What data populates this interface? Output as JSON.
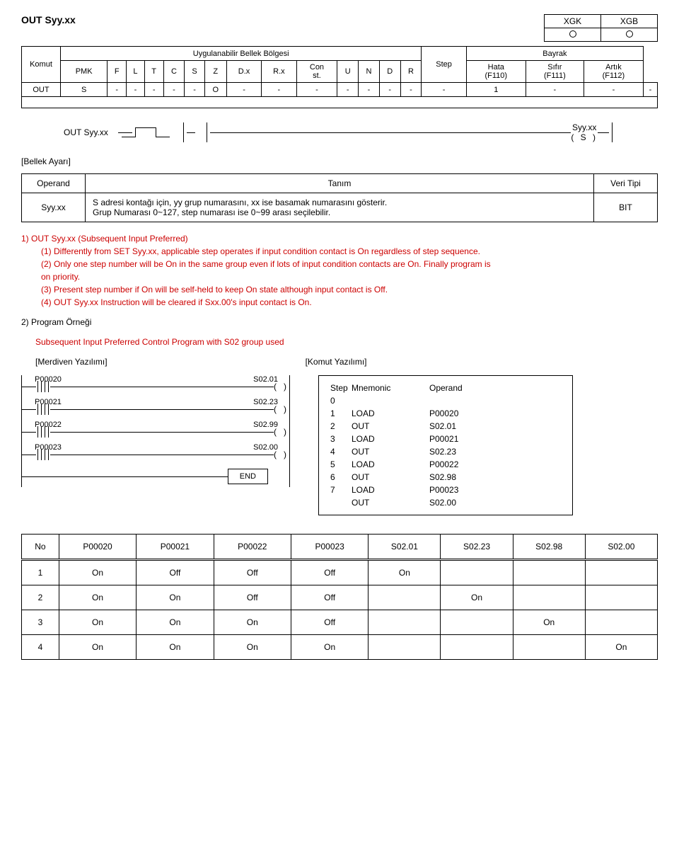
{
  "title": "OUT Syy.xx",
  "xgk": {
    "h1": "XGK",
    "h2": "XGB"
  },
  "table1": {
    "komut": "Komut",
    "area": "Uygulanabilir Bellek Bölgesi",
    "flag": "Bayrak",
    "cols": [
      "PMK",
      "F",
      "L",
      "T",
      "C",
      "S",
      "Z",
      "D.x",
      "R.x",
      "Con\nst.",
      "U",
      "N",
      "D",
      "R",
      "Step",
      "Hata\n(F110)",
      "Sıfır\n(F111)",
      "Artık\n(F112)"
    ],
    "out_label": "OUT",
    "out_s": "S",
    "row": [
      "-",
      "-",
      "-",
      "-",
      "-",
      "O",
      "-",
      "-",
      "-",
      "-",
      "-",
      "-",
      "-",
      "-",
      "1",
      "-",
      "-",
      "-"
    ]
  },
  "ladder1": {
    "label": "OUT Syy.xx",
    "right_top": "Syy.xx",
    "right_coil": "( S )"
  },
  "operand": {
    "header": "[Bellek Ayarı]",
    "h_op": "Operand",
    "h_desc": "Tanım",
    "h_type": "Veri Tipi",
    "op": "Syy.xx",
    "desc": "S adresi kontağı için, yy grup numarasını, xx ise basamak numarasını gösterir.\nGrup Numarası 0~127, step numarası ise 0~99 arası seçilebilir.",
    "type": "BIT"
  },
  "sec1": {
    "title": "1) OUT Syy.xx (Subsequent Input Preferred)",
    "l1": "(1) Differently from SET Syy.xx, applicable step operates if input condition contact is On regardless of step sequence.",
    "l2": "(2) Only one step number will be On in the same group even if lots of input condition contacts are On. Finally program is\n     on  priority.",
    "l3": "(3) Present step number if On will be self-held to keep On state although input contact is Off.",
    "l4": "(4) OUT Syy.xx Instruction will be cleared if Sxx.00's input contact is On."
  },
  "sec2": {
    "title": "2) Program Örneği",
    "sub": "Subsequent Input Preferred Control Program with S02 group used",
    "left": "[Merdiven Yazılımı]",
    "right": "[Komut Yazılımı]"
  },
  "ladder2": {
    "rungs": [
      {
        "c": "P00020",
        "o": "S02.01"
      },
      {
        "c": "P00021",
        "o": "S02.23"
      },
      {
        "c": "P00022",
        "o": "S02.99"
      },
      {
        "c": "P00023",
        "o": "S02.00"
      }
    ],
    "end": "END"
  },
  "mnemonic": {
    "h": [
      "Step",
      "Mnemonic",
      "Operand"
    ],
    "rows": [
      [
        "0",
        "",
        ""
      ],
      [
        "1",
        "LOAD",
        "P00020"
      ],
      [
        "2",
        "OUT",
        "S02.01"
      ],
      [
        "3",
        "LOAD",
        "P00021"
      ],
      [
        "4",
        "OUT",
        "S02.23"
      ],
      [
        "5",
        "LOAD",
        "P00022"
      ],
      [
        "6",
        "OUT",
        "S02.98"
      ],
      [
        "7",
        "LOAD",
        "P00023"
      ],
      [
        "",
        "OUT",
        "S02.00"
      ]
    ]
  },
  "truth": {
    "head": [
      "No",
      "P00020",
      "P00021",
      "P00022",
      "P00023",
      "S02.01",
      "S02.23",
      "S02.98",
      "S02.00"
    ],
    "rows": [
      [
        "1",
        "On",
        "Off",
        "Off",
        "Off",
        "On",
        "",
        "",
        ""
      ],
      [
        "2",
        "On",
        "On",
        "Off",
        "Off",
        "",
        "On",
        "",
        ""
      ],
      [
        "3",
        "On",
        "On",
        "On",
        "Off",
        "",
        "",
        "On",
        ""
      ],
      [
        "4",
        "On",
        "On",
        "On",
        "On",
        "",
        "",
        "",
        "On"
      ]
    ]
  }
}
